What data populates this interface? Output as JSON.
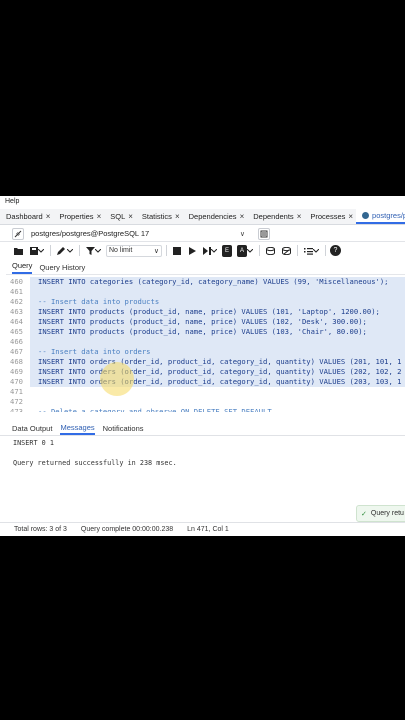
{
  "menu": {
    "help": "Help"
  },
  "tabs": [
    {
      "label": "Dashboard"
    },
    {
      "label": "Properties"
    },
    {
      "label": "SQL"
    },
    {
      "label": "Statistics"
    },
    {
      "label": "Dependencies"
    },
    {
      "label": "Dependents"
    },
    {
      "label": "Processes"
    },
    {
      "label": "postgres/po"
    }
  ],
  "tab_close": "×",
  "connection": {
    "value": "postgres/postgres@PostgreSQL 17",
    "caret": "∨"
  },
  "toolbar": {
    "limit_label": "No limit",
    "limit_caret": "∨",
    "help_label": "?"
  },
  "query_tabs": {
    "query": "Query",
    "history": "Query History"
  },
  "editor_lines": [
    {
      "num": "460",
      "text": "INSERT INTO categories (category_id, category_name) VALUES (99, 'Miscellaneous');",
      "comment": false
    },
    {
      "num": "461",
      "text": "",
      "comment": false
    },
    {
      "num": "462",
      "text": "-- Insert data into products",
      "comment": true
    },
    {
      "num": "463",
      "text": "INSERT INTO products (product_id, name, price) VALUES (101, 'Laptop', 1200.00);",
      "comment": false
    },
    {
      "num": "464",
      "text": "INSERT INTO products (product_id, name, price) VALUES (102, 'Desk', 300.00);",
      "comment": false
    },
    {
      "num": "465",
      "text": "INSERT INTO products (product_id, name, price) VALUES (103, 'Chair', 80.00);",
      "comment": false
    },
    {
      "num": "466",
      "text": "",
      "comment": false
    },
    {
      "num": "467",
      "text": "-- Insert data into orders",
      "comment": true
    },
    {
      "num": "468",
      "text": "INSERT INTO orders (order_id, product_id, category_id, quantity) VALUES (201, 101, 1",
      "comment": false
    },
    {
      "num": "469",
      "text": "INSERT INTO orders (order_id, product_id, category_id, quantity) VALUES (202, 102, 2",
      "comment": false
    },
    {
      "num": "470",
      "text": "INSERT INTO orders (order_id, product_id, category_id, quantity) VALUES (203, 103, 1",
      "comment": false
    },
    {
      "num": "471",
      "text": "",
      "comment": false
    },
    {
      "num": "472",
      "text": "",
      "comment": false
    },
    {
      "num": "473",
      "text": "-- Delete a category and observe ON DELETE SET DEFAULT",
      "comment": true
    }
  ],
  "result_tabs": {
    "data_output": "Data Output",
    "messages": "Messages",
    "notifications": "Notifications"
  },
  "messages": {
    "insert": "INSERT 0 1",
    "result": "Query returned successfully in 238 msec."
  },
  "toast": {
    "icon": "✓",
    "text": "Query retu"
  },
  "status": {
    "rows": "Total rows: 3 of 3",
    "query": "Query complete 00:00:00.238",
    "position": "Ln 471, Col 1"
  }
}
